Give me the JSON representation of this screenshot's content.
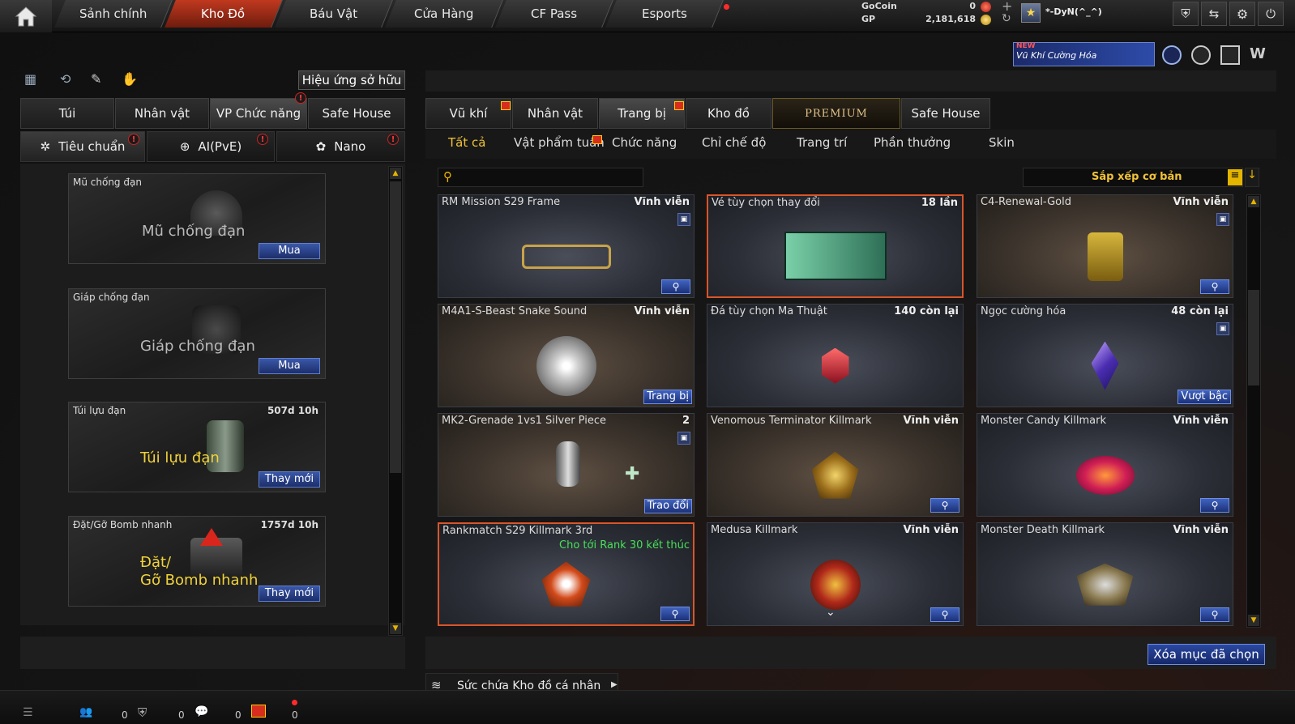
{
  "nav": {
    "tabs": [
      "Sảnh chính",
      "Kho Đồ",
      "Báu Vật",
      "Cửa Hàng",
      "CF Pass",
      "Esports"
    ],
    "active_tab": "Kho Đồ"
  },
  "currency": {
    "gocoin_label": "GoCoin",
    "gocoin_value": "0",
    "gp_label": "GP",
    "gp_value": "2,181,618"
  },
  "player": {
    "name": "*-DyN(^_^)"
  },
  "promo": {
    "new_badge": "NEW",
    "text": "Vũ Khí Cường Hóa"
  },
  "left": {
    "effects_button": "Hiệu ứng sở hữu",
    "tabs": [
      "Túi",
      "Nhân vật",
      "VP Chức năng",
      "Safe House"
    ],
    "active_tab": "VP Chức năng",
    "subtabs": [
      "Tiêu chuẩn",
      "AI(PvE)",
      "Nano"
    ],
    "active_subtab": "Tiêu chuẩn",
    "slots": [
      {
        "title": "Mũ chống đạn",
        "time": "",
        "big": "Mũ chống đạn",
        "action": "Mua"
      },
      {
        "title": "Giáp chống đạn",
        "time": "",
        "big": "Giáp chống đạn",
        "action": "Mua"
      },
      {
        "title": "Túi lựu đạn",
        "time": "507d 10h",
        "big": "Túi lựu đạn",
        "action": "Thay mới"
      },
      {
        "title": "Đặt/Gỡ Bomb nhanh",
        "time": "1757d 10h",
        "big1": "Đặt/",
        "big2": "Gỡ Bomb nhanh",
        "action": "Thay mới"
      }
    ]
  },
  "right": {
    "tabs": [
      "Vũ khí",
      "Nhân vật",
      "Trang bị",
      "Kho đồ",
      "PREMIUM",
      "Safe House"
    ],
    "active_tab": "Trang bị",
    "filters": [
      "Tất cả",
      "Vật phẩm tuần",
      "Chức năng",
      "Chỉ chế độ",
      "Trang trí",
      "Phần thưởng",
      "Skin"
    ],
    "active_filter": "Tất cả",
    "search_placeholder": "",
    "sort_label": "Sắp xếp cơ bản",
    "items": [
      {
        "name": "RM Mission S29 Frame",
        "status": "Vĩnh viễn",
        "action": ""
      },
      {
        "name": "Vé tùy chọn thay đổi",
        "status": "18 lần",
        "action": ""
      },
      {
        "name": "C4-Renewal-Gold",
        "status": "Vĩnh viễn",
        "action": ""
      },
      {
        "name": "M4A1-S-Beast Snake Sound",
        "status": "Vĩnh viễn",
        "action": "Trang bị"
      },
      {
        "name": "Đá tùy chọn Ma Thuật",
        "status": "140 còn lại",
        "action": ""
      },
      {
        "name": "Ngọc cường hóa",
        "status": "48 còn lại",
        "action": "Vượt bậc"
      },
      {
        "name": "MK2-Grenade 1vs1 Silver Piece",
        "status": "2",
        "action": "Trao đổi"
      },
      {
        "name": "Venomous Terminator Killmark",
        "status": "Vĩnh viễn",
        "action": ""
      },
      {
        "name": "Monster Candy Killmark",
        "status": "Vĩnh viễn",
        "action": ""
      },
      {
        "name": "Rankmatch S29 Killmark 3rd",
        "status": "",
        "note": "Cho tới Rank 30 kết thúc",
        "action": ""
      },
      {
        "name": "Medusa Killmark",
        "status": "Vĩnh viễn",
        "action": ""
      },
      {
        "name": "Monster Death Killmark",
        "status": "Vĩnh viễn",
        "action": ""
      }
    ],
    "delete_button": "Xóa mục đã chọn",
    "capacity_label": "Sức chứa Kho đồ cá nhân"
  },
  "bottom": {
    "counts": [
      "0",
      "0",
      "0",
      "0"
    ]
  },
  "colors": {
    "accent_red": "#c0391f",
    "accent_gold": "#f0c238",
    "button_blue": "#2c4aa0",
    "note_green": "#48e05a"
  },
  "icons": [
    "home-icon",
    "gocoin-icon",
    "gp-icon",
    "plus-icon",
    "refresh-icon",
    "rank-icon",
    "shield-icon",
    "exit-icon",
    "gear-icon",
    "power-icon",
    "search-icon",
    "trash-icon",
    "magnifier-icon"
  ]
}
